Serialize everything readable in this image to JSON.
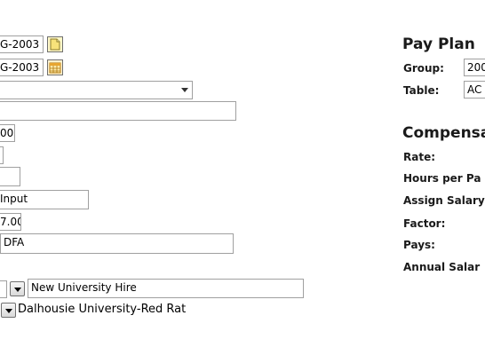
{
  "left": {
    "effective_date": "G-2003",
    "expiry_date": "G-2003",
    "select_value": "",
    "empty_field": "",
    "amount_1": "00",
    "short_1": "",
    "short_2": "",
    "input_source": "Input",
    "amount_2": "7.00",
    "code_value": "DFA",
    "action_reason": "New University Hire",
    "employer": "Dalhousie University-Red Rat"
  },
  "pay_plan": {
    "heading": "Pay Plan",
    "group_label": "Group:",
    "group_value": "200",
    "table_label": "Table:",
    "table_value": "AC"
  },
  "compensation": {
    "heading": "Compensa",
    "rate_label": "Rate:",
    "hours_label": "Hours per Pa",
    "assign_label": "Assign Salary",
    "factor_label": "Factor:",
    "pays_label": "Pays:",
    "annual_label": "Annual Salar"
  },
  "icons": {
    "note": "note-page-icon",
    "calendar": "calendar-icon",
    "dropdown": "chevron-down-icon"
  },
  "colors": {
    "field_border": "#a0a0a0",
    "icon_yellow": "#f7e27a",
    "calendar_orange": "#e8a530"
  }
}
